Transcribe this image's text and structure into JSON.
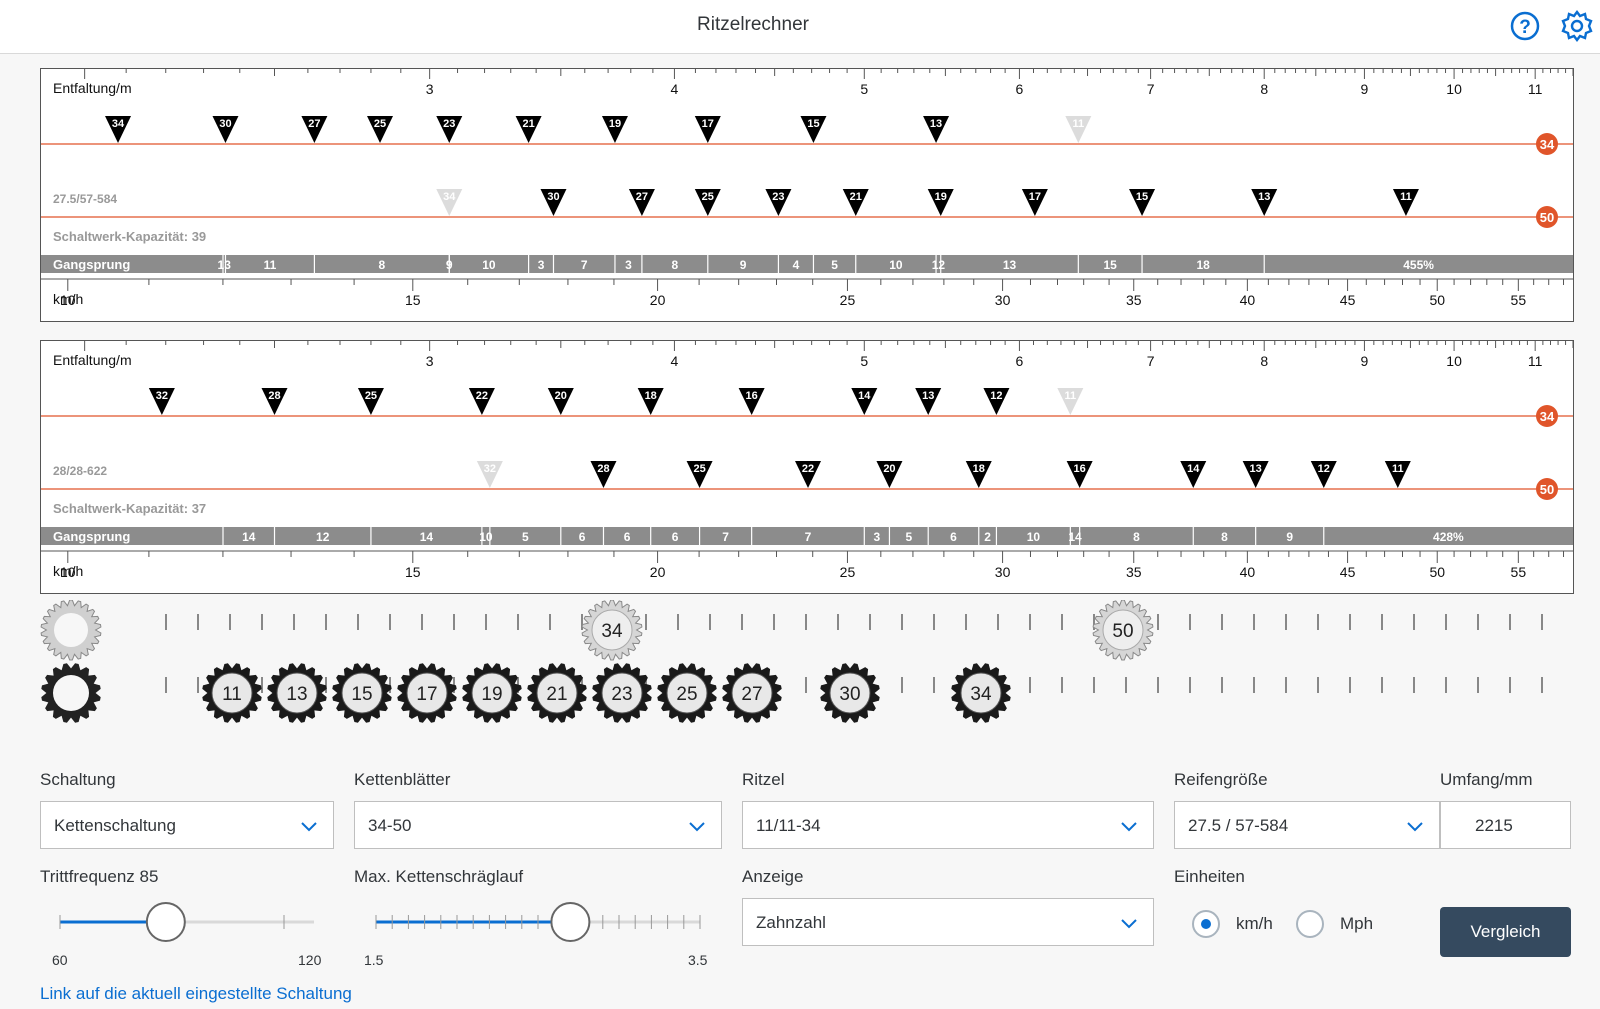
{
  "app": {
    "title": "Ritzelrechner"
  },
  "charts": [
    {
      "tire": "27.5/57-584",
      "capacity": "Schaltwerk-Kapazität: 39",
      "entfaltung_label": "Entfaltung/m",
      "gangsprung_label": "Gangsprung",
      "kmh_label": "km/h",
      "entfaltung_ticks": [
        "3",
        "4",
        "5",
        "6",
        "7",
        "8",
        "9",
        "10",
        "11"
      ],
      "kmh_ticks": [
        "10",
        "15",
        "20",
        "25",
        "30",
        "35",
        "40",
        "45",
        "50",
        "55"
      ],
      "chainrings": [
        {
          "teeth": "34",
          "sprockets": [
            "34",
            "30",
            "27",
            "25",
            "23",
            "21",
            "19",
            "17",
            "15",
            "13",
            "11"
          ],
          "development_m": [
            2.08,
            2.36,
            2.62,
            2.83,
            3.07,
            3.37,
            3.73,
            4.16,
            4.71,
            5.44,
            6.43
          ]
        },
        {
          "teeth": "50",
          "sprockets": [
            "34",
            "30",
            "27",
            "25",
            "23",
            "21",
            "19",
            "17",
            "15",
            "13",
            "11"
          ],
          "development_m": [
            3.07,
            3.47,
            3.85,
            4.16,
            4.52,
            4.95,
            5.47,
            6.11,
            6.93,
            8.0,
            9.45
          ]
        }
      ],
      "gangsprung_values": [
        "13",
        "11",
        "8",
        "9",
        "10",
        "3",
        "7",
        "3",
        "8",
        "9",
        "4",
        "5",
        "10",
        "12",
        "13",
        "15",
        "18",
        "455%"
      ]
    },
    {
      "tire": "28/28-622",
      "capacity": "Schaltwerk-Kapazität: 37",
      "entfaltung_label": "Entfaltung/m",
      "gangsprung_label": "Gangsprung",
      "kmh_label": "km/h",
      "entfaltung_ticks": [
        "3",
        "4",
        "5",
        "6",
        "7",
        "8",
        "9",
        "10",
        "11"
      ],
      "kmh_ticks": [
        "10",
        "15",
        "20",
        "25",
        "30",
        "35",
        "40",
        "45",
        "50",
        "55"
      ],
      "chainrings": [
        {
          "teeth": "34",
          "sprockets": [
            "32",
            "28",
            "25",
            "22",
            "20",
            "18",
            "16",
            "14",
            "13",
            "12",
            "11"
          ],
          "development_m": [
            2.19,
            2.5,
            2.8,
            3.19,
            3.5,
            3.89,
            4.38,
            5.0,
            5.39,
            5.84,
            6.37
          ]
        },
        {
          "teeth": "50",
          "sprockets": [
            "32",
            "28",
            "25",
            "22",
            "20",
            "18",
            "16",
            "14",
            "13",
            "12",
            "11"
          ],
          "development_m": [
            3.22,
            3.68,
            4.12,
            4.68,
            5.15,
            5.72,
            6.44,
            7.36,
            7.92,
            8.58,
            9.36
          ]
        }
      ],
      "gangsprung_values": [
        "14",
        "12",
        "14",
        "10",
        "5",
        "6",
        "6",
        "6",
        "7",
        "7",
        "3",
        "5",
        "6",
        "2",
        "10",
        "14",
        "8",
        "8",
        "9",
        "428%"
      ]
    }
  ],
  "gears": {
    "chainrings": [
      "34",
      "50"
    ],
    "sprockets": [
      "11",
      "13",
      "15",
      "17",
      "19",
      "21",
      "23",
      "25",
      "27",
      "30",
      "34"
    ]
  },
  "form": {
    "schaltung": {
      "label": "Schaltung",
      "value": "Kettenschaltung"
    },
    "kettenblaetter": {
      "label": "Kettenblätter",
      "value": "34-50"
    },
    "ritzel": {
      "label": "Ritzel",
      "value": "11/11-34"
    },
    "reifen": {
      "label": "Reifengröße",
      "value": "27.5 / 57-584"
    },
    "umfang": {
      "label": "Umfang/mm",
      "value": "2215"
    },
    "trittfrequenz": {
      "label": "Trittfrequenz 85",
      "min": "60",
      "max": "120",
      "value": 85
    },
    "schraeglauf": {
      "label": "Max. Kettenschräglauf",
      "min": "1.5",
      "max": "3.5",
      "value": 2.7
    },
    "anzeige": {
      "label": "Anzeige",
      "value": "Zahnzahl"
    },
    "einheiten": {
      "label": "Einheiten",
      "opt1": "km/h",
      "opt2": "Mph",
      "selected": "km/h"
    },
    "vergleich": "Vergleich",
    "link": "Link auf die aktuell eingestellte Schaltung"
  },
  "colors": {
    "accent": "#e0552a",
    "primary": "#0a6ed1",
    "button": "#354a5f"
  }
}
